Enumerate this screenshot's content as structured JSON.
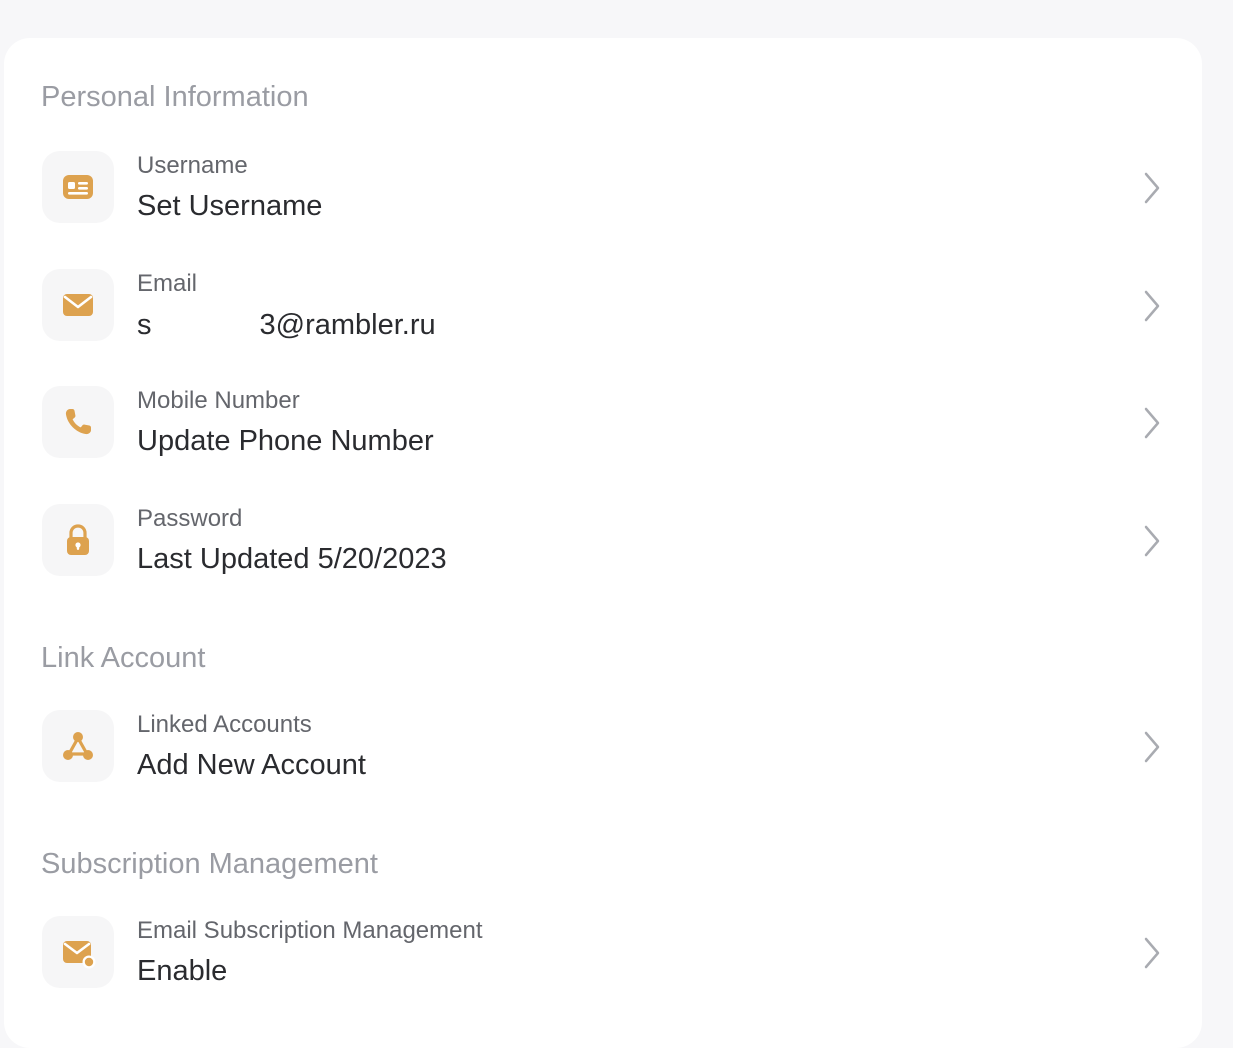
{
  "colors": {
    "accent": "#DDA24F",
    "section_title": "#9A9CA3",
    "label": "#64666C",
    "value": "#2A2B2F",
    "chevron": "#A9ABB1",
    "icon_bg": "#F6F6F7",
    "page_bg": "#F7F7F9",
    "card_bg": "#FFFFFF"
  },
  "sections": {
    "personal": {
      "title": "Personal Information",
      "items": {
        "username": {
          "label": "Username",
          "value": "Set Username",
          "icon": "id-card-icon"
        },
        "email": {
          "label": "Email",
          "value_start": "s",
          "value_end": "3@rambler.ru",
          "icon": "envelope-icon"
        },
        "mobile": {
          "label": "Mobile Number",
          "value": "Update Phone Number",
          "icon": "phone-icon"
        },
        "password": {
          "label": "Password",
          "value": "Last Updated 5/20/2023",
          "icon": "lock-icon"
        }
      }
    },
    "link": {
      "title": "Link Account",
      "items": {
        "linked": {
          "label": "Linked Accounts",
          "value": "Add New Account",
          "icon": "link-nodes-icon"
        }
      }
    },
    "subscription": {
      "title": "Subscription Management",
      "items": {
        "email_sub": {
          "label": "Email Subscription Management",
          "value": "Enable",
          "icon": "envelope-badge-icon"
        }
      }
    }
  }
}
